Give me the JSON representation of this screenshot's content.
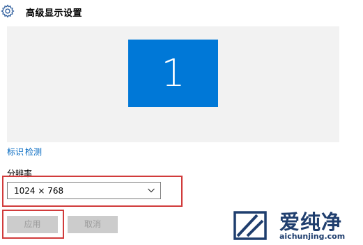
{
  "header": {
    "title": "高级显示设置",
    "icon": "gear-icon"
  },
  "display": {
    "monitor_number": "1",
    "tile_color": "#0078d7",
    "canvas_color": "#f2f2f2"
  },
  "links": {
    "identify": "标识",
    "detect": "检测"
  },
  "resolution": {
    "label": "分辨率",
    "value": "1024 × 768"
  },
  "buttons": {
    "apply": "应用",
    "cancel": "取消"
  },
  "annotation": {
    "highlight_color": "#d13b3b"
  },
  "watermark": {
    "text": "爱纯净",
    "url": "aichunjing.com",
    "color": "#1f3e6e"
  }
}
